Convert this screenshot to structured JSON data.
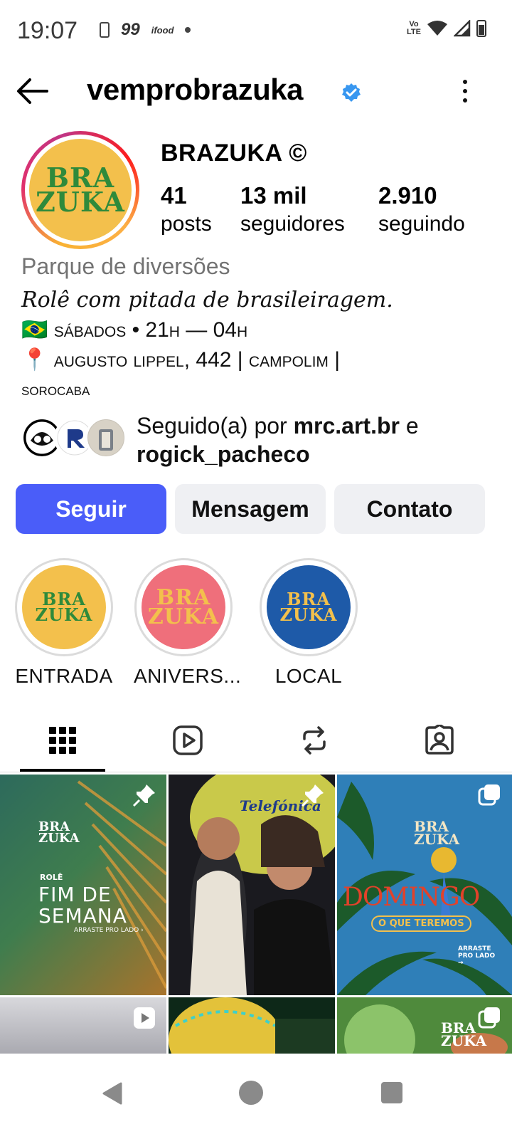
{
  "status_bar": {
    "time": "19:07",
    "app_icons": [
      "phone-icon",
      "99-icon",
      "ifood-icon",
      "dot-icon"
    ],
    "label_99": "99",
    "label_ifood": "ifood",
    "volte_top": "Vo",
    "volte_bottom": "LTE"
  },
  "header": {
    "username": "vemprobrazuka",
    "verified": true,
    "back_icon": "arrow-left-icon",
    "more_icon": "more-vertical-icon"
  },
  "profile": {
    "full_name": "BRAZUKA ©",
    "avatar_logo_line1": "BRA",
    "avatar_logo_line2": "ZUKA",
    "stats": [
      {
        "value": "41",
        "label": "posts"
      },
      {
        "value": "13 mil",
        "label": "seguidores"
      },
      {
        "value": "2.910",
        "label": "seguindo"
      }
    ],
    "category": "Parque de diversões",
    "bio_line1": "Rolê com pitada de brasileiragem.",
    "bio_line2_flag": "🇧🇷",
    "bio_line2": "sábados • 21h — 04h",
    "bio_line3_pin": "📍",
    "bio_line3": "augusto lippel, 442 | campolim |",
    "bio_line4": "sorocaba",
    "followed_by_prefix": "Seguido(a) por ",
    "followed_by_user1": "mrc.art.br",
    "followed_by_and": " e",
    "followed_by_user2": "rogick_pacheco"
  },
  "actions": {
    "follow": "Seguir",
    "message": "Mensagem",
    "contact": "Contato"
  },
  "highlights": [
    {
      "label": "ENTRADA",
      "bg": "#f3c04c",
      "fg": "#2f8a3b",
      "logo1": "BRA",
      "logo2": "ZUKA"
    },
    {
      "label": "ANIVERS...",
      "bg": "#ef6f7b",
      "fg": "#f3c04c",
      "logo1": "BRA",
      "logo2": "ZUKA"
    },
    {
      "label": "LOCAL",
      "bg": "#1e5aa8",
      "fg": "#f3c04c",
      "logo1": "BRA",
      "logo2": "ZUKA"
    }
  ],
  "tabs": [
    "grid-icon",
    "reels-icon",
    "reposts-icon",
    "tagged-icon"
  ],
  "posts": [
    {
      "pinned": true,
      "title1": "FIM DE",
      "title2": "SEMANA",
      "logo1": "BRA",
      "logo2": "ZUKA",
      "label_role": "ROLÊ",
      "label_cta": "ARRASTE PRO LADO ›"
    },
    {
      "pinned": true,
      "sign": "Telefónica"
    },
    {
      "carousel": true,
      "title": "DOMINGO",
      "subtitle": "O QUE TEREMOS",
      "logo1": "BRA",
      "logo2": "ZUKA",
      "cta": "ARRASTE PRO LADO →"
    },
    {
      "reel": true
    },
    {},
    {
      "carousel": true,
      "logo1": "BRA",
      "logo2": "ZUKA"
    }
  ],
  "colors": {
    "accent": "#4a5df9",
    "verified": "#3897f0",
    "secondary_button": "#eff0f3",
    "muted_text": "#737373"
  }
}
